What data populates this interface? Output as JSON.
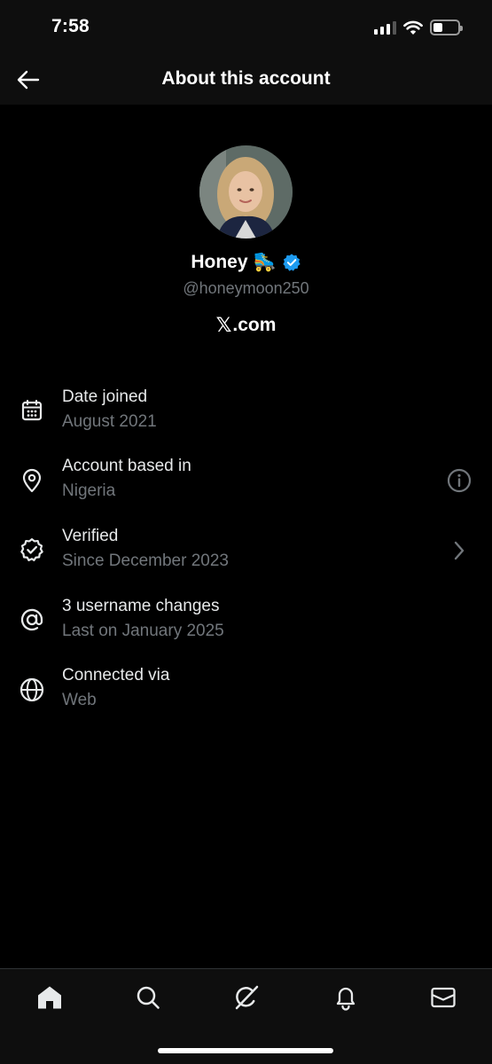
{
  "status_bar": {
    "time": "7:58",
    "battery_level": 0.4
  },
  "header": {
    "title": "About this account",
    "back_icon": "arrow-left-icon"
  },
  "profile": {
    "display_name": "Honey",
    "name_emoji": "🛼",
    "verified_badge_color": "#1d9bf0",
    "handle": "@honeymoon250",
    "site_mark": "𝕏",
    "site_text": ".com"
  },
  "info_items": [
    {
      "icon": "calendar-icon",
      "title": "Date joined",
      "subtitle": "August 2021"
    },
    {
      "icon": "location-pin-icon",
      "title": "Account based in",
      "subtitle": "Nigeria",
      "action_icon": "info-icon"
    },
    {
      "icon": "verified-badge-icon",
      "title": "Verified",
      "subtitle": "Since December 2023",
      "action_icon": "chevron-right-icon"
    },
    {
      "icon": "at-sign-icon",
      "title": "3 username changes",
      "subtitle": "Last on January 2025"
    },
    {
      "icon": "globe-icon",
      "title": "Connected via",
      "subtitle": "Web"
    }
  ],
  "bottom_nav": [
    "home-icon",
    "search-icon",
    "grok-icon",
    "bell-icon",
    "mail-icon"
  ],
  "colors": {
    "background": "#000000",
    "secondary_text": "#71767b",
    "accent": "#1d9bf0"
  }
}
